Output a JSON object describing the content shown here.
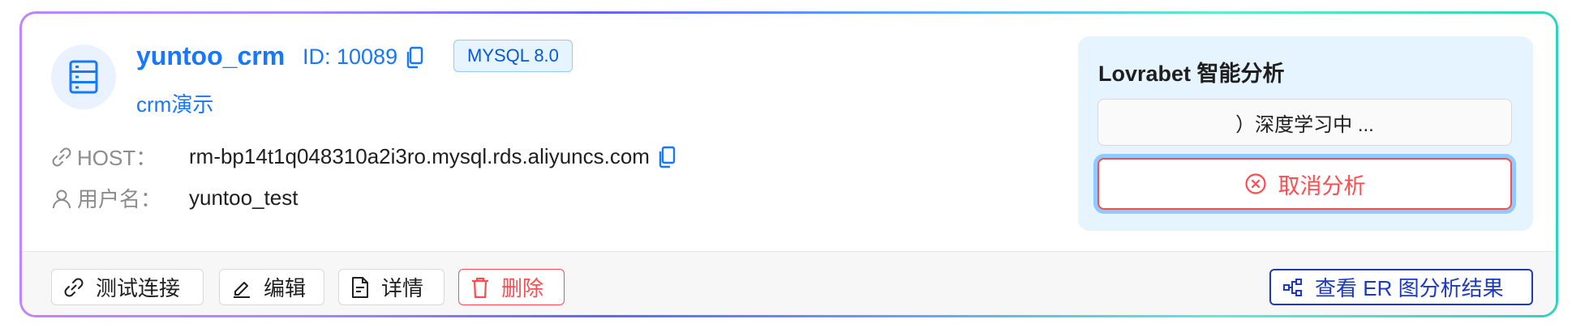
{
  "db": {
    "name": "yuntoo_crm",
    "id_text": "ID: 10089",
    "type_badge": "MYSQL 8.0",
    "description": "crm演示"
  },
  "fields": {
    "host_label": "HOST：",
    "host_value": "rm-bp14t1q048310a2i3ro.mysql.rds.aliyuncs.com",
    "user_label": "用户名：",
    "user_value": "yuntoo_test"
  },
  "ai_panel": {
    "title": "Lovrabet 智能分析",
    "status": "）深度学习中 ...",
    "cancel_label": "取消分析"
  },
  "actions": {
    "test_connection": "测试连接",
    "edit": "编辑",
    "details": "详情",
    "delete": "删除",
    "view_er": "查看 ER 图分析结果"
  },
  "icons": [
    "database-icon",
    "copy-icon",
    "link-icon",
    "user-icon",
    "close-circle-icon",
    "edit-icon",
    "file-icon",
    "delete-icon",
    "er-diagram-icon"
  ],
  "colors": {
    "primary": "#1677ff",
    "danger": "#ff4d4f",
    "panel_bg": "#e6f4ff",
    "er_button": "#1d39c4"
  }
}
